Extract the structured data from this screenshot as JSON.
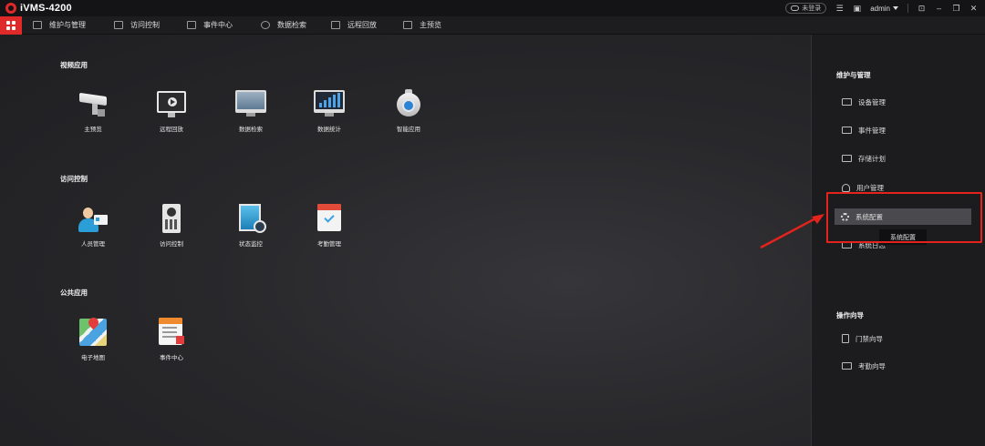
{
  "window": {
    "title": "iVMS-4200",
    "login_status": "未登录",
    "user": "admin"
  },
  "menubar": {
    "items": [
      {
        "label": "维护与管理",
        "icon": "maintenance-icon"
      },
      {
        "label": "访问控制",
        "icon": "access-control-icon"
      },
      {
        "label": "事件中心",
        "icon": "event-center-icon"
      },
      {
        "label": "数据检索",
        "icon": "data-search-icon"
      },
      {
        "label": "远程回放",
        "icon": "remote-playback-icon"
      },
      {
        "label": "主预览",
        "icon": "main-preview-icon"
      }
    ]
  },
  "main": {
    "sections": [
      {
        "title": "视频应用",
        "apps": [
          "主预览",
          "远程回放",
          "数据检索",
          "数据统计",
          "智能应用"
        ]
      },
      {
        "title": "访问控制",
        "apps": [
          "人员管理",
          "访问控制",
          "状态监控",
          "考勤管理"
        ]
      },
      {
        "title": "公共应用",
        "apps": [
          "电子地图",
          "事件中心"
        ]
      }
    ]
  },
  "right_panel": {
    "sections": [
      {
        "title": "维护与管理",
        "items": [
          "设备管理",
          "事件管理",
          "存储计划",
          "用户管理",
          "系统配置",
          "系统日志"
        ]
      },
      {
        "title": "操作向导",
        "items": [
          "门禁向导",
          "考勤向导"
        ]
      }
    ],
    "tooltip": "系统配置"
  },
  "colors": {
    "accent": "#e02a2a",
    "annotation": "#e3231c"
  }
}
